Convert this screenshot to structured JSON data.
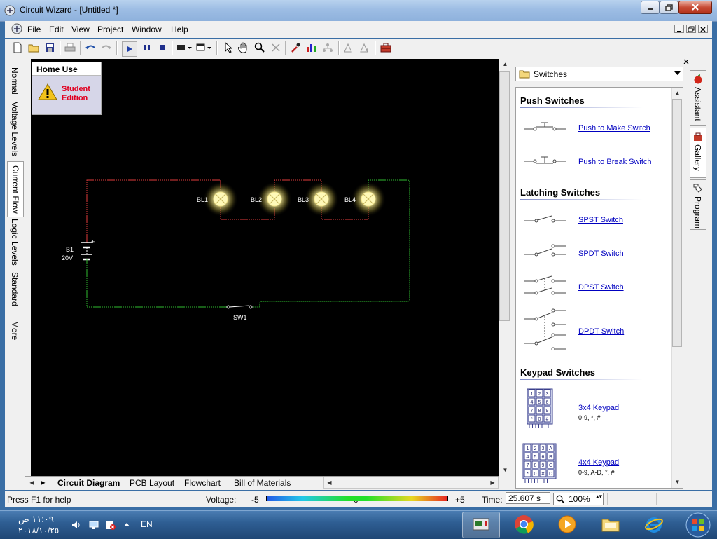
{
  "window": {
    "title": "Circuit Wizard - [Untitled *]"
  },
  "menu": [
    "File",
    "Edit",
    "View",
    "Project",
    "Window",
    "Help"
  ],
  "left_tabs": [
    "Normal",
    "Voltage Levels",
    "Current Flow",
    "Logic Levels",
    "Standard",
    "More"
  ],
  "home_box": {
    "heading": "Home Use",
    "line1": "Student",
    "line2": "Edition"
  },
  "circuit": {
    "battery_name": "B1",
    "battery_value": "20V",
    "battery_plus": "+",
    "bulbs": [
      "BL1",
      "BL2",
      "BL3",
      "BL4"
    ],
    "switch": "SW1",
    "colors": {
      "positive": "#e23c3c",
      "negative": "#2fbd2f",
      "bulb_glow": "#fffaa0"
    }
  },
  "bottom_tabs": [
    "Circuit Diagram",
    "PCB Layout",
    "Flowchart",
    "Bill of Materials"
  ],
  "gallery": {
    "category": "Switches",
    "sections": [
      {
        "title": "Push Switches",
        "items": [
          {
            "label": "Push to Make Switch",
            "icon": "push-to-make-switch-icon"
          },
          {
            "label": "Push to Break Switch",
            "icon": "push-to-break-switch-icon"
          }
        ]
      },
      {
        "title": "Latching Switches",
        "items": [
          {
            "label": "SPST Switch",
            "icon": "spst-switch-icon"
          },
          {
            "label": "SPDT Switch",
            "icon": "spdt-switch-icon"
          },
          {
            "label": "DPST Switch",
            "icon": "dpst-switch-icon"
          },
          {
            "label": "DPDT Switch",
            "icon": "dpdt-switch-icon"
          }
        ]
      },
      {
        "title": "Keypad Switches",
        "items": [
          {
            "label": "3x4 Keypad",
            "sub": "0-9, *, #",
            "icon": "keypad-3x4-icon"
          },
          {
            "label": "4x4 Keypad",
            "sub": "0-9, A-D, *, #",
            "icon": "keypad-4x4-icon"
          }
        ]
      }
    ]
  },
  "right_tabs": [
    "Assistant",
    "Gallery",
    "Program"
  ],
  "status": {
    "help": "Press F1 for help",
    "voltage_label": "Voltage:",
    "volt_min": "-5",
    "volt_mid": "0",
    "volt_max": "+5",
    "time_label": "Time:",
    "time_value": "25.607 s",
    "zoom": "100%"
  },
  "taskbar": {
    "time": "١١:٠٩ ص",
    "date": "٢٠١٨/١٠/٢٥",
    "language": "EN"
  }
}
